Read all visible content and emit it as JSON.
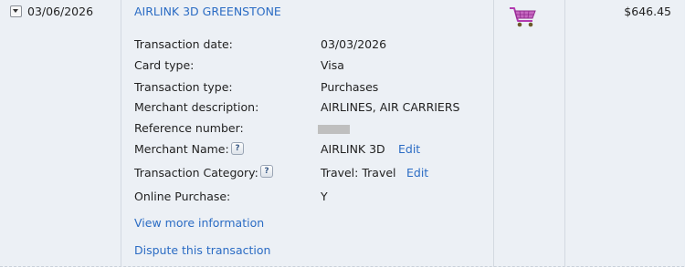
{
  "transaction": {
    "posted_date": "03/06/2026",
    "merchant_title": "AIRLINK 3D GREENSTONE",
    "amount": "$646.45"
  },
  "details": {
    "transaction_date_label": "Transaction date:",
    "transaction_date_value": "03/03/2026",
    "card_type_label": "Card type:",
    "card_type_value": "Visa",
    "transaction_type_label": "Transaction type:",
    "transaction_type_value": "Purchases",
    "merchant_description_label": "Merchant description:",
    "merchant_description_value": "AIRLINES, AIR CARRIERS",
    "reference_number_label": "Reference number:",
    "merchant_name_label": "Merchant Name:",
    "merchant_name_value": "AIRLINK 3D",
    "transaction_category_label": "Transaction Category:",
    "transaction_category_value": "Travel: Travel",
    "online_purchase_label": "Online Purchase:",
    "online_purchase_value": "Y"
  },
  "actions": {
    "edit_label": "Edit",
    "help_glyph": "?",
    "view_more": "View more information",
    "dispute": "Dispute this transaction"
  },
  "colors": {
    "link": "#2b6cc4",
    "background": "#ecf0f5",
    "cart": "#b23ab0"
  },
  "icons": {
    "expand": "chevron-down-icon",
    "cart": "shopping-cart-icon",
    "help": "help-icon"
  }
}
